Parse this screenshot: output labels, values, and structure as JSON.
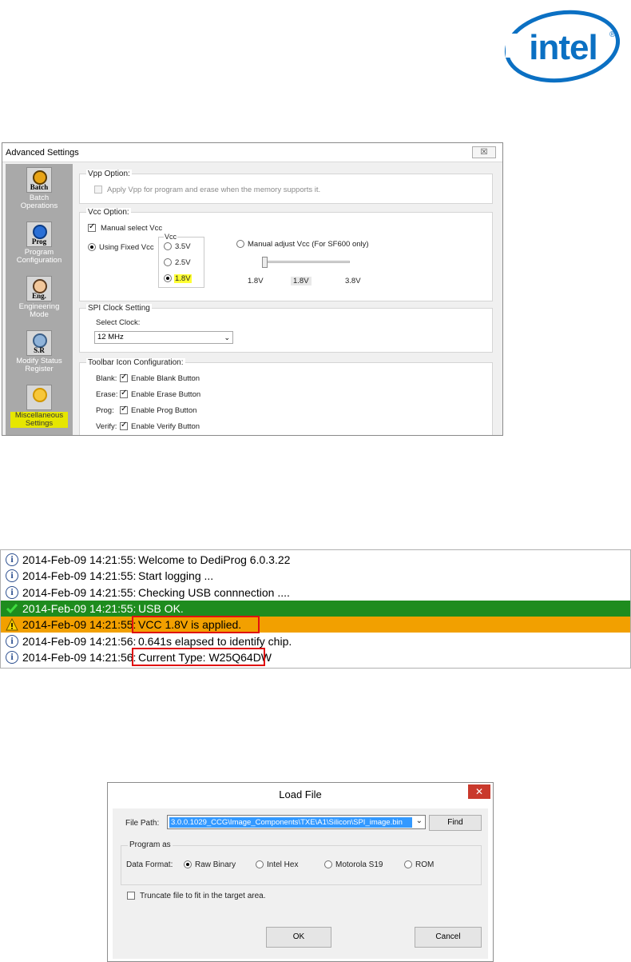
{
  "logo": {
    "brand": "intel"
  },
  "advanced_settings": {
    "title": "Advanced Settings",
    "close_glyph": "☒",
    "sidebar": [
      {
        "caption": "Batch",
        "label_lines": [
          "Batch",
          "Operations"
        ],
        "icon": "batch-icon"
      },
      {
        "caption": "Prog",
        "label_lines": [
          "Program",
          "Configuration"
        ],
        "icon": "program-icon"
      },
      {
        "caption": "Eng.",
        "label_lines": [
          "Engineering",
          "Mode"
        ],
        "icon": "engineering-icon"
      },
      {
        "caption": "S.R",
        "label_lines": [
          "Modify Status",
          "Register"
        ],
        "icon": "status-register-icon"
      },
      {
        "caption": "",
        "label_lines": [
          "Miscellaneous",
          "Settings"
        ],
        "icon": "misc-settings-icon",
        "active": true
      }
    ],
    "vpp": {
      "legend": "Vpp Option:",
      "checkbox_label": "Apply Vpp for program and erase when the memory supports it."
    },
    "vcc": {
      "legend": "Vcc Option:",
      "manual_select": "Manual select Vcc",
      "using_fixed": "Using Fixed Vcc",
      "vcc_label": "Vcc",
      "options": [
        "3.5V",
        "2.5V",
        "1.8V"
      ],
      "selected": "1.8V",
      "manual_adjust": "Manual adjust Vcc (For SF600 only)",
      "slider_min": "1.8V",
      "slider_value": "1.8V",
      "slider_max": "3.8V"
    },
    "spi": {
      "legend": "SPI Clock Setting",
      "label": "Select Clock:",
      "value": "12 MHz"
    },
    "toolbar": {
      "legend": "Toolbar Icon Configuration:",
      "items": [
        {
          "key": "Blank:",
          "label": "Enable Blank Button"
        },
        {
          "key": "Erase:",
          "label": "Enable Erase Button"
        },
        {
          "key": "Prog:",
          "label": "Enable Prog Button"
        },
        {
          "key": "Verify:",
          "label": "Enable Verify Button"
        }
      ]
    }
  },
  "log": {
    "rows": [
      {
        "ts": "2014-Feb-09 14:21:55:",
        "msg": "Welcome to DediProg  6.0.3.22",
        "kind": "info"
      },
      {
        "ts": "2014-Feb-09 14:21:55:",
        "msg": "Start logging ...",
        "kind": "info"
      },
      {
        "ts": "2014-Feb-09 14:21:55:",
        "msg": "Checking USB connnection ....",
        "kind": "info"
      },
      {
        "ts": "2014-Feb-09 14:21:55:",
        "msg": "USB OK.",
        "kind": "success"
      },
      {
        "ts": "2014-Feb-09 14:21:55:",
        "msg": "VCC 1.8V is applied.",
        "kind": "warning"
      },
      {
        "ts": "2014-Feb-09 14:21:56:",
        "msg": "0.641s elapsed to identify chip.",
        "kind": "info"
      },
      {
        "ts": "2014-Feb-09 14:21:56:",
        "msg": "Current Type: W25Q64DW",
        "kind": "info"
      }
    ],
    "colors": {
      "success": "#1e8c1e",
      "warning": "#f2a000",
      "highlight_box": "#e01010"
    }
  },
  "load_file": {
    "title": "Load File",
    "close_glyph": "✕",
    "file_path_label": "File Path:",
    "file_path_value": "3.0.0.1029_CCG\\Image_Components\\TXE\\A1\\Silicon\\SPI_image.bin",
    "find_button": "Find",
    "program_as_legend": "Program as",
    "data_format_label": "Data Format:",
    "formats": [
      "Raw Binary",
      "Intel Hex",
      "Motorola S19",
      "ROM"
    ],
    "selected_format": "Raw Binary",
    "truncate_label": "Truncate file to fit in the target area.",
    "ok_button": "OK",
    "cancel_button": "Cancel"
  }
}
